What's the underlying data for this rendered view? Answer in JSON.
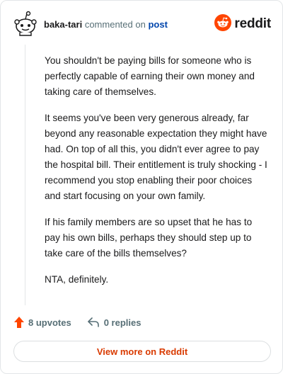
{
  "comment": {
    "username": "baka-tari",
    "action_text": "commented on",
    "post_link": "post",
    "paragraphs": [
      "You shouldn't be paying bills for someone who is perfectly capable of earning their own money and taking care of themselves.",
      "It seems you've been very generous already, far beyond any reasonable expectation they might have had. On top of all this, you didn't ever agree to pay the hospital bill. Their entitlement is truly shocking - I recommend you stop enabling their poor choices and start focusing on your own family.",
      "If his family members are so upset that he has to pay his own bills, perhaps they should step up to take care of the bills themselves?",
      "NTA, definitely."
    ]
  },
  "brand": {
    "name": "reddit",
    "icon": "reddit-logo-icon",
    "color": "#ff4500"
  },
  "actions": {
    "upvotes_label": "8 upvotes",
    "replies_label": "0 replies",
    "upvote_icon": "upvote-arrow-icon",
    "reply_icon": "reply-arrow-icon"
  },
  "footer": {
    "view_more_label": "View more on Reddit"
  },
  "colors": {
    "accent": "#ff4500",
    "link": "#0045ac",
    "muted": "#576f76",
    "text": "#1a1a1b",
    "button_text": "#d93a00"
  }
}
